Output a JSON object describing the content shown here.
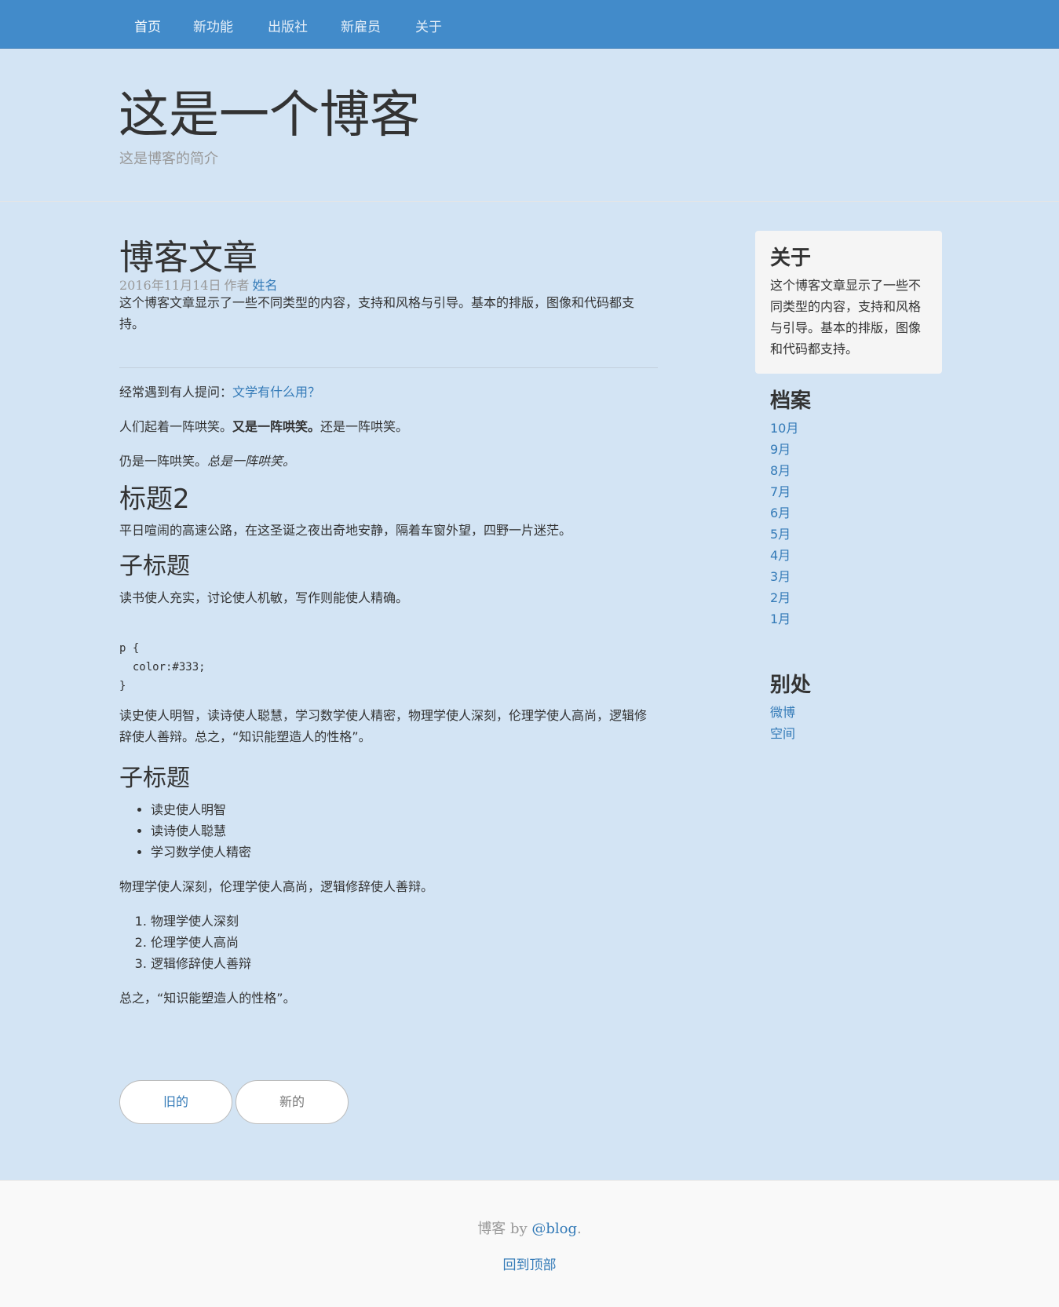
{
  "nav": {
    "items": [
      "首页",
      "新功能",
      "出版社",
      "新雇员",
      "关于"
    ]
  },
  "header": {
    "title": "这是一个博客",
    "description": "这是博客的简介"
  },
  "post": {
    "title": "博客文章",
    "date": "2016年11月14日",
    "author_label": "作者",
    "author": "姓名",
    "intro": "这个博客文章显示了一些不同类型的内容，支持和风格与引导。基本的排版，图像和代码都支持。",
    "p1_prefix": "经常遇到有人提问：",
    "p1_link": "文学有什么用？",
    "p2_a": "人们起着一阵哄笑。",
    "p2_b": "又是一阵哄笑。",
    "p2_c": "还是一阵哄笑。",
    "p3_a": "仍是一阵哄笑。",
    "p3_b": "总是一阵哄笑。",
    "h2": "标题2",
    "p4": "平日喧闹的高速公路，在这圣诞之夜出奇地安静，隔着车窗外望，四野一片迷茫。",
    "h3a": "子标题",
    "p5": "读书使人充实，讨论使人机敏，写作则能使人精确。",
    "code": "p {\n  color:#333;\n}",
    "p6": "读史使人明智，读诗使人聪慧，学习数学使人精密，物理学使人深刻，伦理学使人高尚，逻辑修辞使人善辩。总之，“知识能塑造人的性格”。",
    "h3b": "子标题",
    "ul": [
      "读史使人明智",
      "读诗使人聪慧",
      "学习数学使人精密"
    ],
    "p7": "物理学使人深刻，伦理学使人高尚，逻辑修辞使人善辩。",
    "ol": [
      "物理学使人深刻",
      "伦理学使人高尚",
      "逻辑修辞使人善辩"
    ],
    "p8": "总之，“知识能塑造人的性格”。"
  },
  "pager": {
    "older": "旧的",
    "newer": "新的"
  },
  "sidebar": {
    "about_title": "关于",
    "about_text": "这个博客文章显示了一些不同类型的内容，支持和风格与引导。基本的排版，图像和代码都支持。",
    "archive_title": "档案",
    "archives": [
      "10月",
      "9月",
      "8月",
      "7月",
      "6月",
      "5月",
      "4月",
      "3月",
      "2月",
      "1月"
    ],
    "elsewhere_title": "别处",
    "elsewhere": [
      "微博",
      "空间"
    ]
  },
  "footer": {
    "credit_prefix": "博客 by ",
    "credit_link": "@blog",
    "credit_suffix": ".",
    "back_to_top": "回到顶部"
  },
  "colors": {
    "nav_bg": "#428bca",
    "page_bg": "#d3e4f4",
    "link": "#337ab7",
    "footer_bg": "#f9f9f9"
  }
}
